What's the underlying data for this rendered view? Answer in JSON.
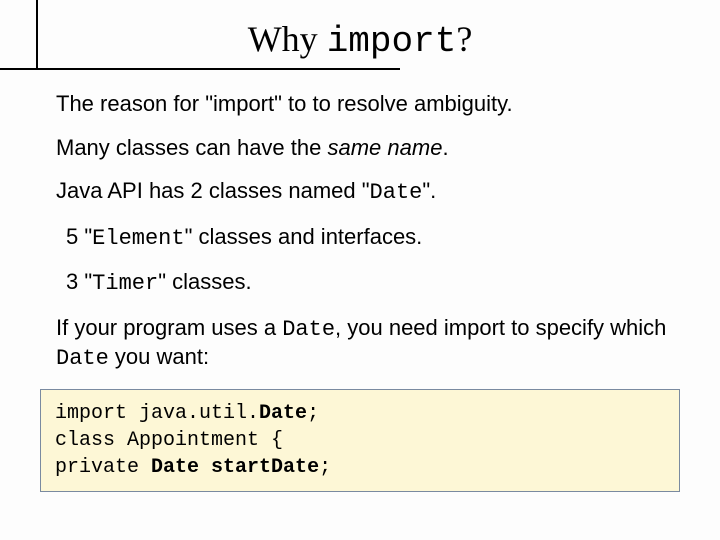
{
  "title": {
    "pre": "Why ",
    "code": "import",
    "post": "?"
  },
  "lines": {
    "l1": "The reason for \"import\" to to resolve ambiguity.",
    "l2_pre": "Many classes can have the ",
    "l2_em": "same name",
    "l2_post": ".",
    "l3_pre": "Java API has 2 classes named \"",
    "l3_code": "Date",
    "l3_post": "\".",
    "l4_pre": " 5 \"",
    "l4_code": "Element",
    "l4_post": "\" classes and interfaces.",
    "l5_pre": " 3 \"",
    "l5_code": "Timer",
    "l5_post": "\" classes.",
    "l6_pre": "If your program uses a ",
    "l6_code": "Date",
    "l6_mid": ", you need import to specify which ",
    "l6_code2": "Date",
    "l6_post": " you want:"
  },
  "code": {
    "c1_a": "import java.util.",
    "c1_b": "Date",
    "c1_c": ";",
    "c2": "class Appointment {",
    "c3_a": "private ",
    "c3_b": "Date",
    "c3_c": " ",
    "c3_d": "startDate",
    "c3_e": ";"
  }
}
